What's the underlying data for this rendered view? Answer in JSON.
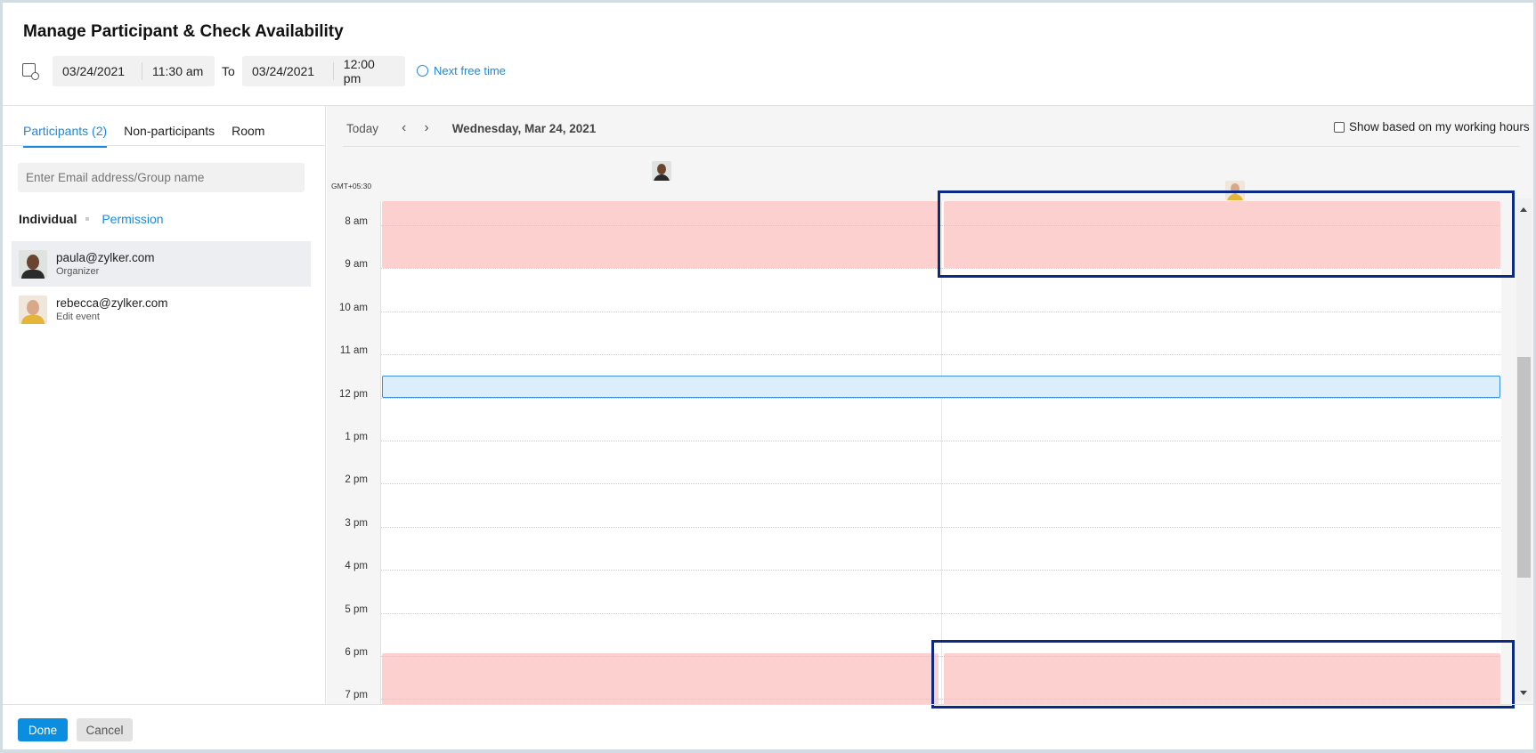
{
  "dialog": {
    "title": "Manage Participant & Check Availability"
  },
  "time_range": {
    "start_date": "03/24/2021",
    "start_time": "11:30 am",
    "to_label": "To",
    "end_date": "03/24/2021",
    "end_time": "12:00 pm",
    "next_free_label": "Next free time"
  },
  "left_panel": {
    "tabs": [
      {
        "label": "Participants (2)",
        "active": true
      },
      {
        "label": "Non-participants"
      },
      {
        "label": "Room"
      }
    ],
    "search_placeholder": "Enter Email address/Group name",
    "subtabs": {
      "individual": "Individual",
      "permission": "Permission"
    },
    "participants": [
      {
        "email": "paula@zylker.com",
        "role": "Organizer",
        "selected": true
      },
      {
        "email": "rebecca@zylker.com",
        "role": "Edit event"
      }
    ]
  },
  "calendar": {
    "today_label": "Today",
    "date_label": "Wednesday, Mar 24, 2021",
    "working_hours_label": "Show based on my working hours",
    "working_hours_checked": false,
    "timezone": "GMT+05:30",
    "hours": [
      "8 am",
      "9 am",
      "10 am",
      "11 am",
      "12 pm",
      "1 pm",
      "2 pm",
      "3 pm",
      "4 pm",
      "5 pm",
      "6 pm",
      "7 pm"
    ],
    "busy": [
      {
        "participant": 0,
        "start": 7.5,
        "end": 9.05
      },
      {
        "participant": 1,
        "start": 7.5,
        "end": 9.05
      },
      {
        "participant": 0,
        "start": 18,
        "end": 19.4
      },
      {
        "participant": 1,
        "start": 18,
        "end": 19.4
      }
    ],
    "event": {
      "start": 11.5,
      "end": 12
    },
    "colors": {
      "busy": "#fdd0d0",
      "event": "#dcedfb",
      "event_border": "#3a8fdc",
      "highlight": "#0a2a85"
    }
  },
  "footer": {
    "done": "Done",
    "cancel": "Cancel"
  }
}
